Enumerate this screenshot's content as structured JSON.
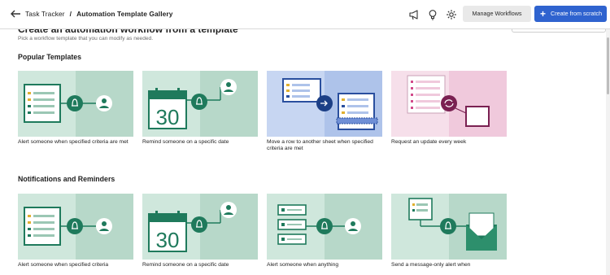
{
  "header": {
    "app": "Task Tracker",
    "separator": "/",
    "page": "Automation Template Gallery",
    "manage_label": "Manage Workflows",
    "create_label": "Create from scratch",
    "icons": [
      "back-arrow-icon",
      "megaphone-icon",
      "lightbulb-icon",
      "gear-icon"
    ]
  },
  "intro": {
    "title": "Create an automation workflow from a template",
    "subtitle": "Pick a workflow template that you can modify as needed."
  },
  "sections": [
    {
      "title": "Popular Templates",
      "cards": [
        {
          "title": "Alert someone when specified criteria are met",
          "theme": "alert"
        },
        {
          "title": "Remind someone on a specific date",
          "theme": "remind"
        },
        {
          "title": "Move a row to another sheet when specified criteria are met",
          "theme": "move"
        },
        {
          "title": "Request an update every week",
          "theme": "request"
        }
      ]
    },
    {
      "title": "Notifications and Reminders",
      "cards": [
        {
          "title": "Alert someone when specified criteria",
          "theme": "alert"
        },
        {
          "title": "Remind someone on a specific date",
          "theme": "remind"
        },
        {
          "title": "Alert someone when anything",
          "theme": "anything"
        },
        {
          "title": "Send a message-only alert when",
          "theme": "message"
        }
      ]
    }
  ],
  "calendar_number": "30",
  "colors": {
    "green_dark": "#1f7a5c",
    "green_bg": "#cfe7dc",
    "blue_bg": "#aec3ea",
    "pink_bg": "#f3d3e3",
    "accent": "#2f63cf"
  }
}
